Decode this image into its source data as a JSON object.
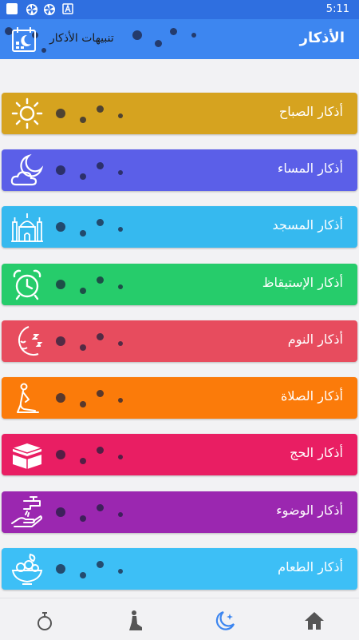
{
  "status_bar": {
    "time": "5:11",
    "icons": [
      "square-icon",
      "pinwheel-icon",
      "pinwheel-icon",
      "letter-a-icon"
    ]
  },
  "app_bar": {
    "title": "الأذكار",
    "notifications_label": "تنبيهات الأذكار",
    "notifications_icon": "calendar-moon-icon"
  },
  "cards": [
    {
      "label": "أذكار الصباح",
      "color": "#d6a31f",
      "icon": "sun-icon"
    },
    {
      "label": "أذكار المساء",
      "color": "#5b5fe8",
      "icon": "moon-cloud-icon"
    },
    {
      "label": "أذكار المسجد",
      "color": "#36b9ef",
      "icon": "mosque-icon"
    },
    {
      "label": "أذكار الإستيقاظ",
      "color": "#26cc6b",
      "icon": "alarm-clock-icon"
    },
    {
      "label": "أذكار النوم",
      "color": "#e74c5e",
      "icon": "sleeping-moon-icon"
    },
    {
      "label": "أذكار الصلاة",
      "color": "#fb7b0a",
      "icon": "praying-person-icon"
    },
    {
      "label": "أذكار الحج",
      "color": "#e91e63",
      "icon": "kaaba-icon"
    },
    {
      "label": "أذكار الوضوء",
      "color": "#9b27b0",
      "icon": "faucet-hand-icon"
    },
    {
      "label": "أذكار الطعام",
      "color": "#3dbff6",
      "icon": "food-bowl-icon"
    }
  ],
  "bottom_nav": {
    "items": [
      "tasbih-icon",
      "prayer-icon",
      "moon-star-icon",
      "home-icon"
    ],
    "active_color": "#3d86f0",
    "inactive_color": "#555555"
  }
}
